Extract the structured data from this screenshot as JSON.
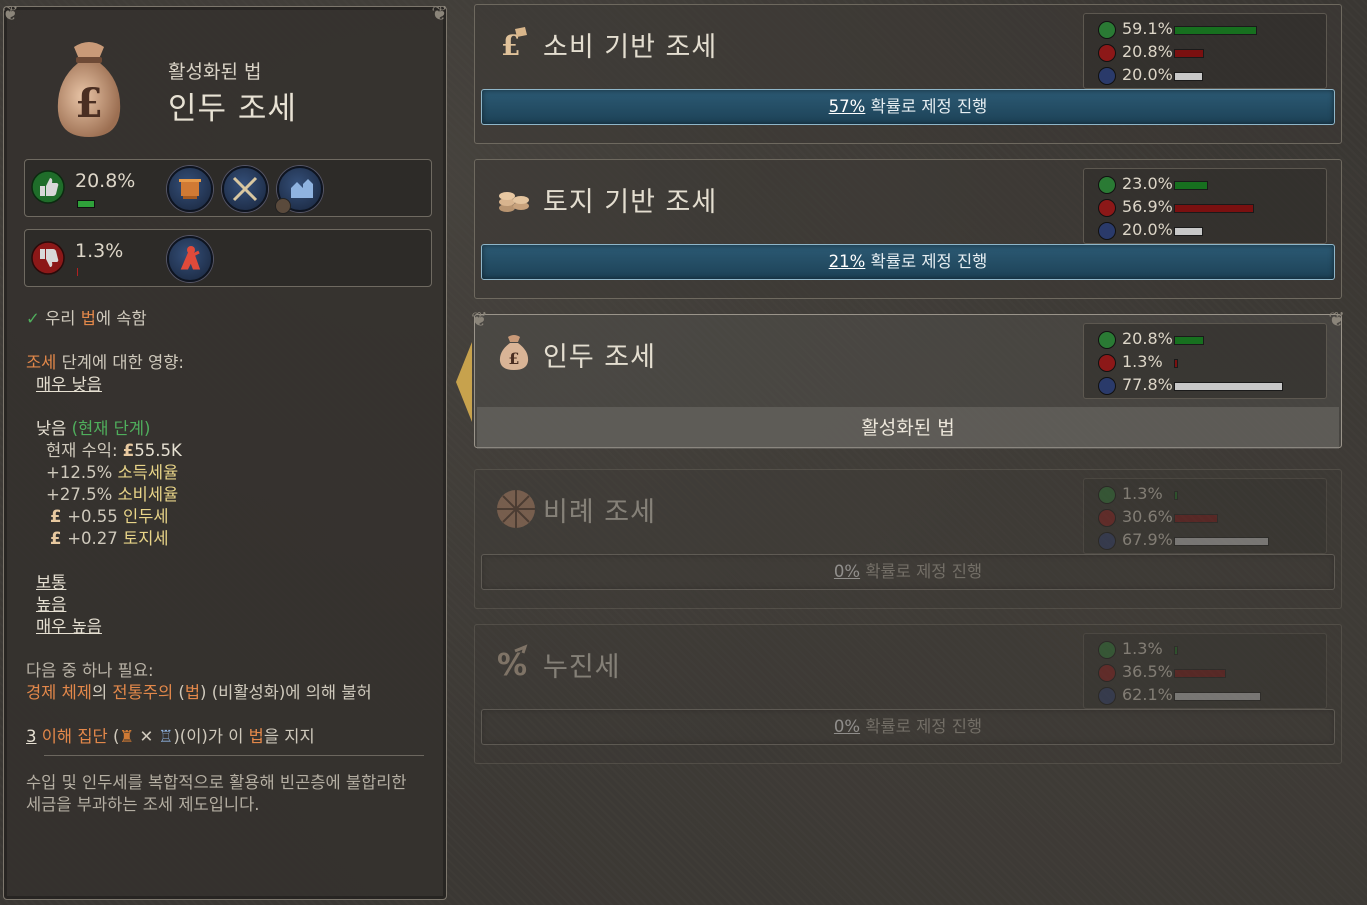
{
  "left_panel": {
    "subtitle": "활성화된 법",
    "title": "인두 조세",
    "approve": {
      "pct": "20.8%",
      "color": "#2fa13a"
    },
    "disapprove": {
      "pct": "1.3%",
      "color": "#b22020"
    },
    "belongs": {
      "check": "✓",
      "a": "우리 ",
      "b": "법",
      "c": "에 속함"
    },
    "tax_level": {
      "a": "조세",
      "b": " 단계에 대한 영향:"
    },
    "levels": {
      "very_low": "매우 낮음",
      "low": "낮음",
      "current": "(현재 단계)",
      "income_label": "현재 수익:",
      "income_value": "55.5K",
      "mod1_val": "+12.5% ",
      "mod1_name": "소득세율",
      "mod2_val": "+27.5% ",
      "mod2_name": "소비세율",
      "mod3_val": "+0.55 ",
      "mod3_name": "인두세",
      "mod4_val": "+0.27 ",
      "mod4_name": "토지세",
      "normal": "보통",
      "high": "높음",
      "very_high": "매우 높음"
    },
    "requirement": {
      "header": "다음 중 하나 필요:",
      "a": "경제 체제",
      "b": "의 ",
      "c": "전통주의",
      "d": " (",
      "e": "법",
      "f": ") (비활성화)에 의해 불허"
    },
    "support": {
      "count": "3",
      "label": " 이해 집단",
      "open": " (",
      "sep": " ✕ ",
      "close": ")(이)가 이 ",
      "law": "법",
      "end": "을 지지"
    },
    "description_line1": "수입 및 인두세를 복합적으로 활용해 빈곤층에 불합리한",
    "description_line2": "세금을 부과하는 조세 제도입니다."
  },
  "laws": [
    {
      "name": "소비 기반 조세",
      "icon": "consumption-tax-icon",
      "approve": "59.1%",
      "approve_frac": 0.591,
      "disapprove": "20.8%",
      "disapprove_frac": 0.208,
      "neutral": "20.0%",
      "neutral_frac": 0.2,
      "chance": "57%",
      "button_rest": " 확률로 제정 진행",
      "state": "enact"
    },
    {
      "name": "토지 기반 조세",
      "icon": "land-tax-icon",
      "approve": "23.0%",
      "approve_frac": 0.23,
      "disapprove": "56.9%",
      "disapprove_frac": 0.569,
      "neutral": "20.0%",
      "neutral_frac": 0.2,
      "chance": "21%",
      "button_rest": " 확률로 제정 진행",
      "state": "enact"
    },
    {
      "name": "인두 조세",
      "icon": "money-bag-icon",
      "approve": "20.8%",
      "approve_frac": 0.208,
      "disapprove": "1.3%",
      "disapprove_frac": 0.013,
      "neutral": "77.8%",
      "neutral_frac": 0.778,
      "active_label": "활성화된 법",
      "state": "active"
    },
    {
      "name": "비례 조세",
      "icon": "proportional-tax-icon",
      "approve": "1.3%",
      "approve_frac": 0.013,
      "disapprove": "30.6%",
      "disapprove_frac": 0.306,
      "neutral": "67.9%",
      "neutral_frac": 0.679,
      "chance": "0%",
      "button_rest": " 확률로 제정 진행",
      "state": "disabled"
    },
    {
      "name": "누진세",
      "icon": "progressive-tax-icon",
      "approve": "1.3%",
      "approve_frac": 0.013,
      "disapprove": "36.5%",
      "disapprove_frac": 0.365,
      "neutral": "62.1%",
      "neutral_frac": 0.621,
      "chance": "0%",
      "button_rest": " 확률로 제정 진행",
      "state": "disabled"
    }
  ],
  "colors": {
    "approve_bar": "#17701f",
    "disapprove_bar": "#7a1010",
    "neutral_bar": "#c8c8c8",
    "button_blue": "#24506a",
    "gold_arrow": "#c7a24d"
  }
}
